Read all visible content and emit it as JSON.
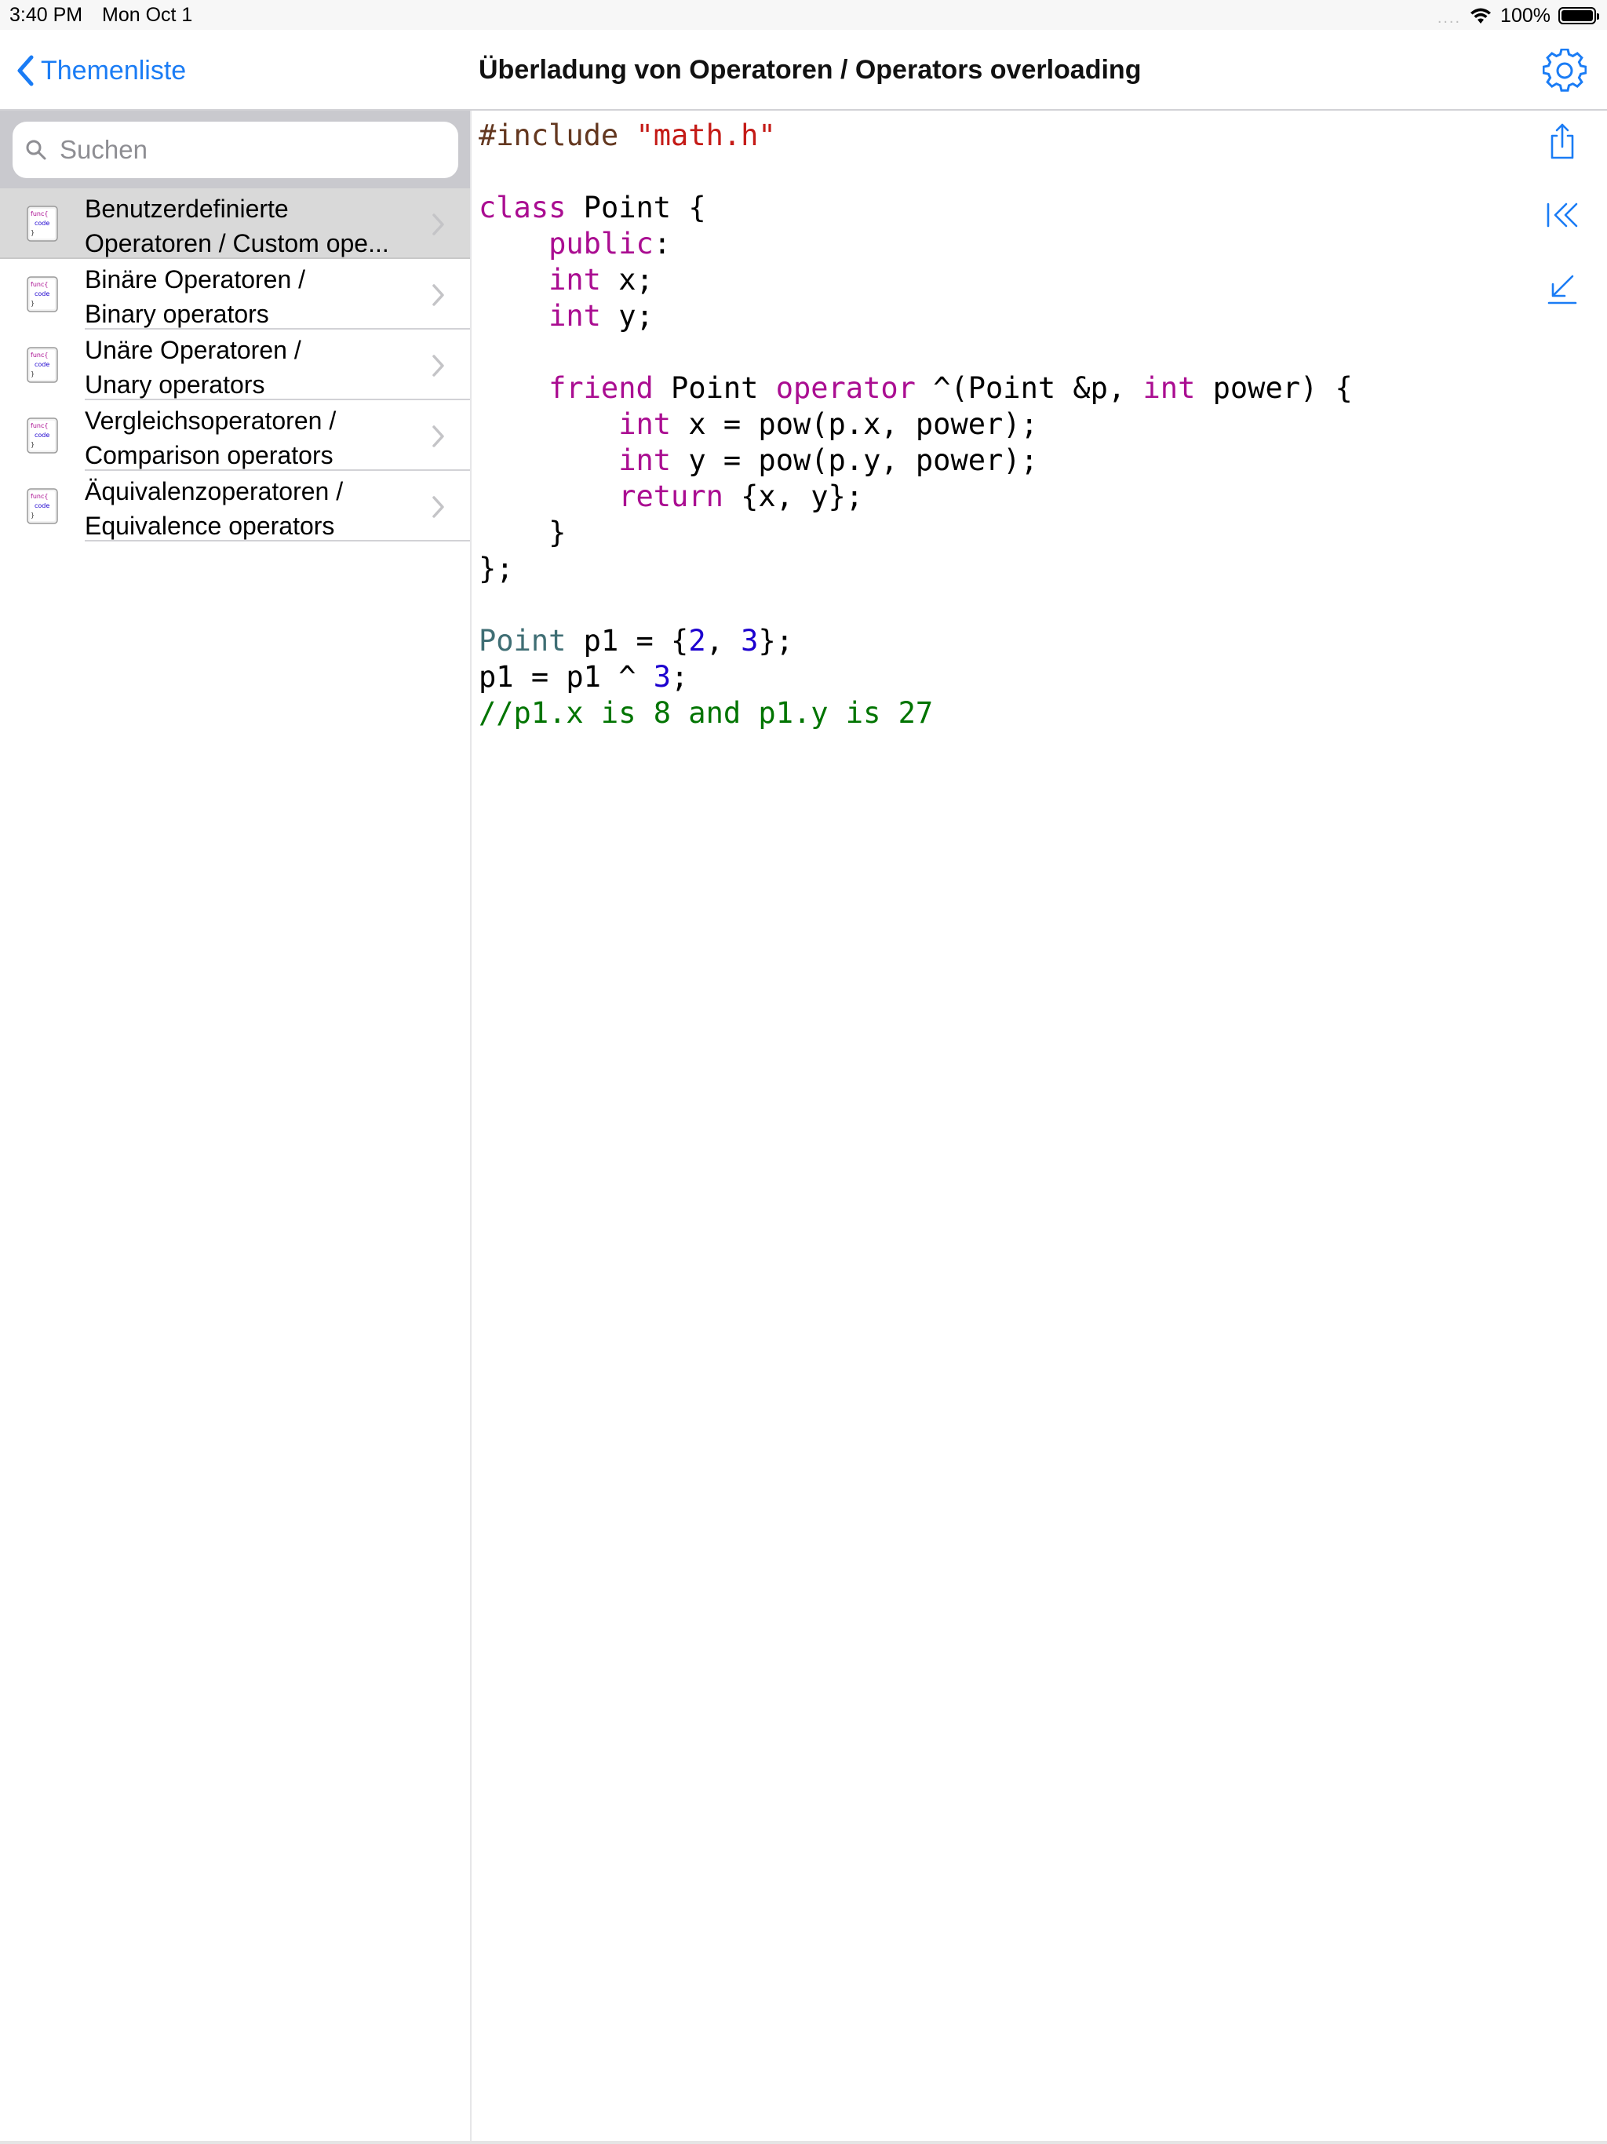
{
  "status_bar": {
    "time": "3:40 PM",
    "date": "Mon Oct 1",
    "signal_dots": "....",
    "battery_percent": "100%",
    "battery_level": 1.0
  },
  "nav": {
    "back_label": "Themenliste",
    "title": "Überladung von Operatoren / Operators overloading",
    "accent_color": "#1a7cf5"
  },
  "sidebar": {
    "search_placeholder": "Suchen",
    "icon_text": [
      "func{",
      "code",
      "}"
    ],
    "items": [
      {
        "line1": "Benutzerdefinierte",
        "line2": "Operatoren / Custom ope...",
        "selected": true
      },
      {
        "line1": "Binäre Operatoren /",
        "line2": "Binary operators",
        "selected": false
      },
      {
        "line1": "Unäre Operatoren /",
        "line2": "Unary operators",
        "selected": false
      },
      {
        "line1": "Vergleichsoperatoren /",
        "line2": "Comparison operators",
        "selected": false
      },
      {
        "line1": "Äquivalenzoperatoren /",
        "line2": "Equivalence operators",
        "selected": false
      }
    ]
  },
  "code": {
    "lines": [
      [
        {
          "t": "#include ",
          "c": "pre"
        },
        {
          "t": "\"math.h\"",
          "c": "str"
        }
      ],
      [],
      [
        {
          "t": "class",
          "c": "kw"
        },
        {
          "t": " Point {",
          "c": ""
        }
      ],
      [
        {
          "t": "    ",
          "c": ""
        },
        {
          "t": "public",
          "c": "kw"
        },
        {
          "t": ":",
          "c": ""
        }
      ],
      [
        {
          "t": "    ",
          "c": ""
        },
        {
          "t": "int",
          "c": "kw"
        },
        {
          "t": " x;",
          "c": ""
        }
      ],
      [
        {
          "t": "    ",
          "c": ""
        },
        {
          "t": "int",
          "c": "kw"
        },
        {
          "t": " y;",
          "c": ""
        }
      ],
      [],
      [
        {
          "t": "    ",
          "c": ""
        },
        {
          "t": "friend",
          "c": "kw"
        },
        {
          "t": " Point ",
          "c": ""
        },
        {
          "t": "operator",
          "c": "kw"
        },
        {
          "t": " ^(Point &p, ",
          "c": ""
        },
        {
          "t": "int",
          "c": "kw"
        },
        {
          "t": " power) {",
          "c": ""
        }
      ],
      [
        {
          "t": "        ",
          "c": ""
        },
        {
          "t": "int",
          "c": "kw"
        },
        {
          "t": " x = pow(p.x, power);",
          "c": ""
        }
      ],
      [
        {
          "t": "        ",
          "c": ""
        },
        {
          "t": "int",
          "c": "kw"
        },
        {
          "t": " y = pow(p.y, power);",
          "c": ""
        }
      ],
      [
        {
          "t": "        ",
          "c": ""
        },
        {
          "t": "return",
          "c": "kw"
        },
        {
          "t": " {x, y};",
          "c": ""
        }
      ],
      [
        {
          "t": "    }",
          "c": ""
        }
      ],
      [
        {
          "t": "};",
          "c": ""
        }
      ],
      [],
      [
        {
          "t": "Point",
          "c": "type"
        },
        {
          "t": " p1 = {",
          "c": ""
        },
        {
          "t": "2",
          "c": "num"
        },
        {
          "t": ", ",
          "c": ""
        },
        {
          "t": "3",
          "c": "num"
        },
        {
          "t": "};",
          "c": ""
        }
      ],
      [
        {
          "t": "p1 = p1 ^ ",
          "c": ""
        },
        {
          "t": "3",
          "c": "num"
        },
        {
          "t": ";",
          "c": ""
        }
      ],
      [
        {
          "t": "//p1.x is 8 and p1.y is 27",
          "c": "cmt"
        }
      ]
    ]
  },
  "toolbar": {
    "icons": [
      "share-icon",
      "jump-to-start-icon",
      "collapse-icon"
    ]
  }
}
